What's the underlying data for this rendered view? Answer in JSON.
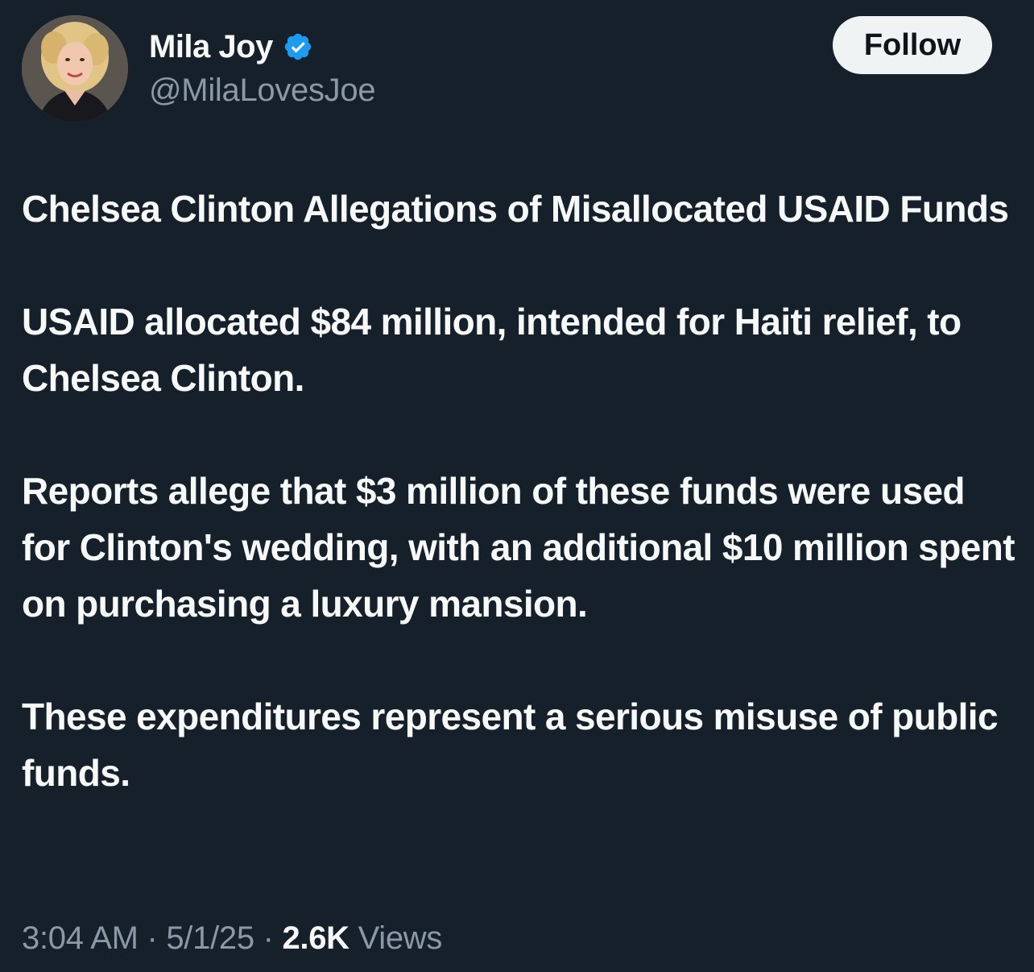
{
  "author": {
    "display_name": "Mila Joy",
    "handle": "@MilaLovesJoe",
    "verified": true,
    "verified_color": "#1d9bf0"
  },
  "follow_button": {
    "label": "Follow"
  },
  "tweet": {
    "paragraphs": [
      "Chelsea Clinton Allegations of Misallocated USAID Funds",
      "USAID allocated $84 million, intended for Haiti relief, to Chelsea Clinton.",
      "Reports allege that $3 million of these funds were used for Clinton's wedding, with an additional $10 million spent on purchasing a luxury mansion.",
      "These expenditures represent a serious misuse of public funds."
    ]
  },
  "meta": {
    "time": "3:04 AM",
    "separator": "·",
    "date": "5/1/25",
    "views_count": "2.6K",
    "views_label": "Views"
  },
  "colors": {
    "background": "#15202b",
    "primary_text": "#f7f9f9",
    "secondary_text": "#8b98a5",
    "button_bg": "#eff3f4"
  }
}
